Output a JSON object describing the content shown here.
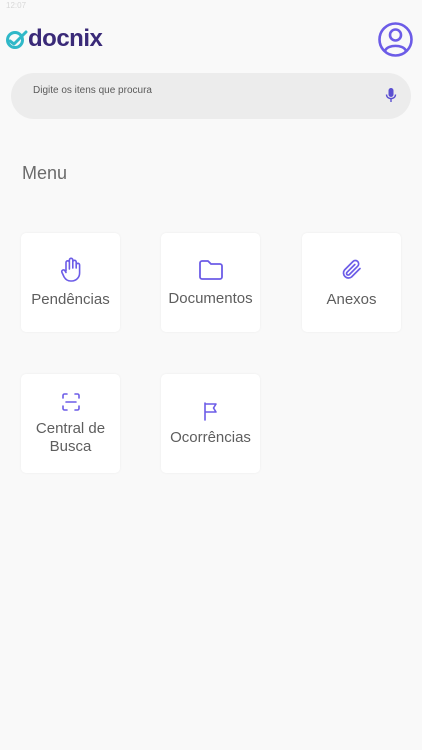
{
  "status_bar": {
    "time": "12:07"
  },
  "header": {
    "app_name": "docnix",
    "brand_color": "#3a2a78",
    "accent_color": "#2fb8c8",
    "profile_icon": "user-circle-icon"
  },
  "search": {
    "placeholder": "Digite os itens que procura",
    "value": "",
    "mic_icon": "microphone-icon"
  },
  "menu": {
    "title": "Menu",
    "icon_color": "#6c5ce7",
    "items": [
      {
        "label": "Pendências",
        "icon": "hand-icon"
      },
      {
        "label": "Documentos",
        "icon": "folder-icon"
      },
      {
        "label": "Anexos",
        "icon": "paperclip-icon"
      },
      {
        "label": "Central de Busca",
        "icon": "scan-icon"
      },
      {
        "label": "Ocorrências",
        "icon": "flag-icon"
      }
    ]
  }
}
